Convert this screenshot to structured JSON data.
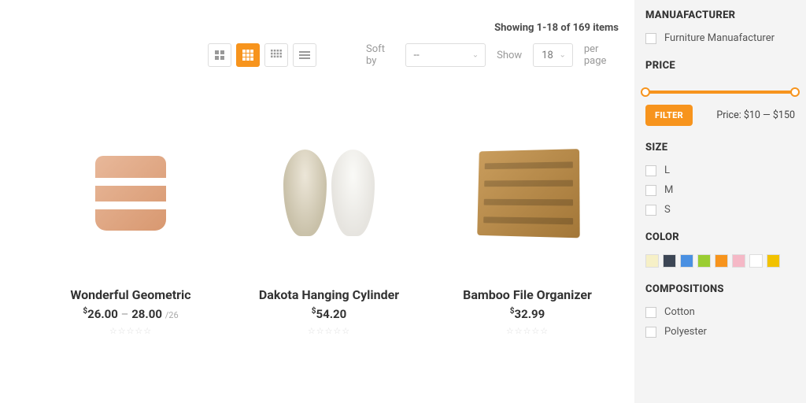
{
  "header": {
    "showing_text": "Showing 1-18 of 169 items"
  },
  "controls": {
    "sort_label": "Soft by",
    "sort_value": "--",
    "show_label": "Show",
    "show_value": "18",
    "per_page": "per page"
  },
  "products": [
    {
      "title": "Wonderful Geometric",
      "price_low": "26.00",
      "price_high": "28.00",
      "price_sub": "/26"
    },
    {
      "title": "Dakota Hanging Cylinder",
      "price": "54.20"
    },
    {
      "title": "Bamboo File Organizer",
      "price": "32.99"
    }
  ],
  "currency": "$",
  "dash": "–",
  "stars": "☆☆☆☆☆",
  "filters": {
    "manufacturer": {
      "heading": "MANUAFACTURER",
      "items": [
        "Furniture Manuafacturer"
      ]
    },
    "price": {
      "heading": "PRICE",
      "button": "FILTER",
      "text": "Price: $10 — $150",
      "min": 10,
      "max": 150
    },
    "size": {
      "heading": "SIZE",
      "items": [
        "L",
        "M",
        "S"
      ]
    },
    "color": {
      "heading": "COLOR",
      "swatches": [
        "#f6f0c7",
        "#3c4655",
        "#4a90e2",
        "#9acd32",
        "#f7941d",
        "#f5b8c6",
        "#ffffff",
        "#f2c200"
      ]
    },
    "compositions": {
      "heading": "COMPOSITIONS",
      "items": [
        "Cotton",
        "Polyester"
      ]
    }
  }
}
